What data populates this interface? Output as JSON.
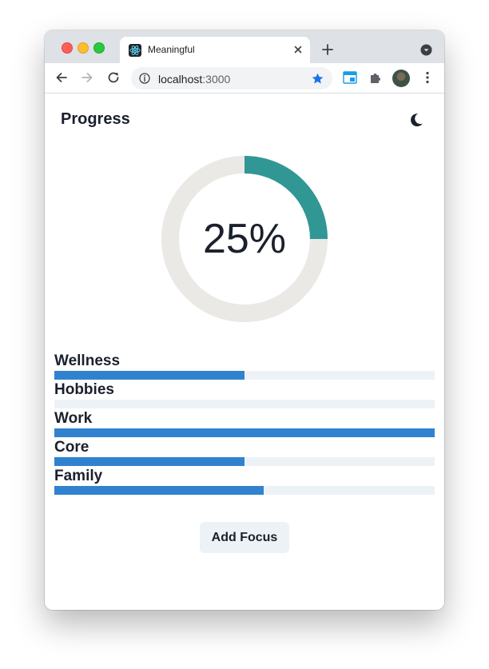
{
  "browser": {
    "tab_title": "Meaningful",
    "url_host": "localhost",
    "url_port": ":3000"
  },
  "app": {
    "title": "Progress",
    "theme_toggle_icon": "moon-icon",
    "overall_progress": {
      "percent": 25,
      "label": "25%",
      "ring_color": "#319795",
      "track_color": "#ebe9e6"
    },
    "focus_areas": [
      {
        "name": "Wellness",
        "progress": 0.5
      },
      {
        "name": "Hobbies",
        "progress": 0
      },
      {
        "name": "Work",
        "progress": 1.0
      },
      {
        "name": "Core",
        "progress": 0.5
      },
      {
        "name": "Family",
        "progress": 0.55
      }
    ],
    "bar_color": "#3182ce",
    "bar_track_color": "#edf2f7",
    "add_button_label": "Add Focus"
  }
}
